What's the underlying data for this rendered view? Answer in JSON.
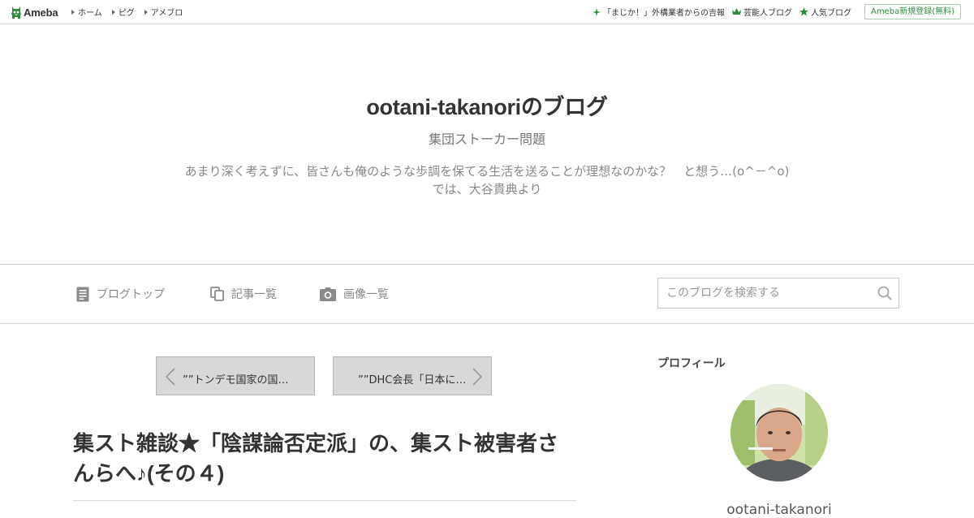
{
  "global_header": {
    "logo_text": "Ameba",
    "nav": [
      {
        "label": "ホーム"
      },
      {
        "label": "ピグ"
      },
      {
        "label": "アメブロ"
      }
    ],
    "right_links": [
      {
        "label": "「まじか！」外構業者からの吉報",
        "icon": "sparkle-icon"
      },
      {
        "label": "芸能人ブログ",
        "icon": "crown-icon"
      },
      {
        "label": "人気ブログ",
        "icon": "star-icon"
      }
    ],
    "signup_label": "Ameba新規登録(無料)",
    "accent_color": "#2d8c3c"
  },
  "blog_header": {
    "title": "ootani-takanoriのブログ",
    "subtitle": "集団ストーカー問題",
    "description_line1": "あまり深く考えずに、皆さんも俺のような歩調を保てる生活を送ることが理想なのかな？　と想う…(o^－^o)",
    "description_line2": "では、大谷貴典より"
  },
  "blog_nav": {
    "items": [
      {
        "label": "ブログトップ",
        "icon": "document-icon"
      },
      {
        "label": "記事一覧",
        "icon": "copy-icon"
      },
      {
        "label": "画像一覧",
        "icon": "camera-icon"
      }
    ],
    "search": {
      "placeholder": "このブログを検索する",
      "value": "",
      "icon": "search-icon"
    }
  },
  "main": {
    "prev_entry": "””トンデモ国家の国…",
    "next_entry": "””DHC会長「日本に…",
    "entry_title": "集スト雑談★「陰謀論否定派」の、集スト被害者さんらへ♪(その４)"
  },
  "sidebar": {
    "heading": "プロフィール",
    "profile_name": "ootani-takanori"
  }
}
